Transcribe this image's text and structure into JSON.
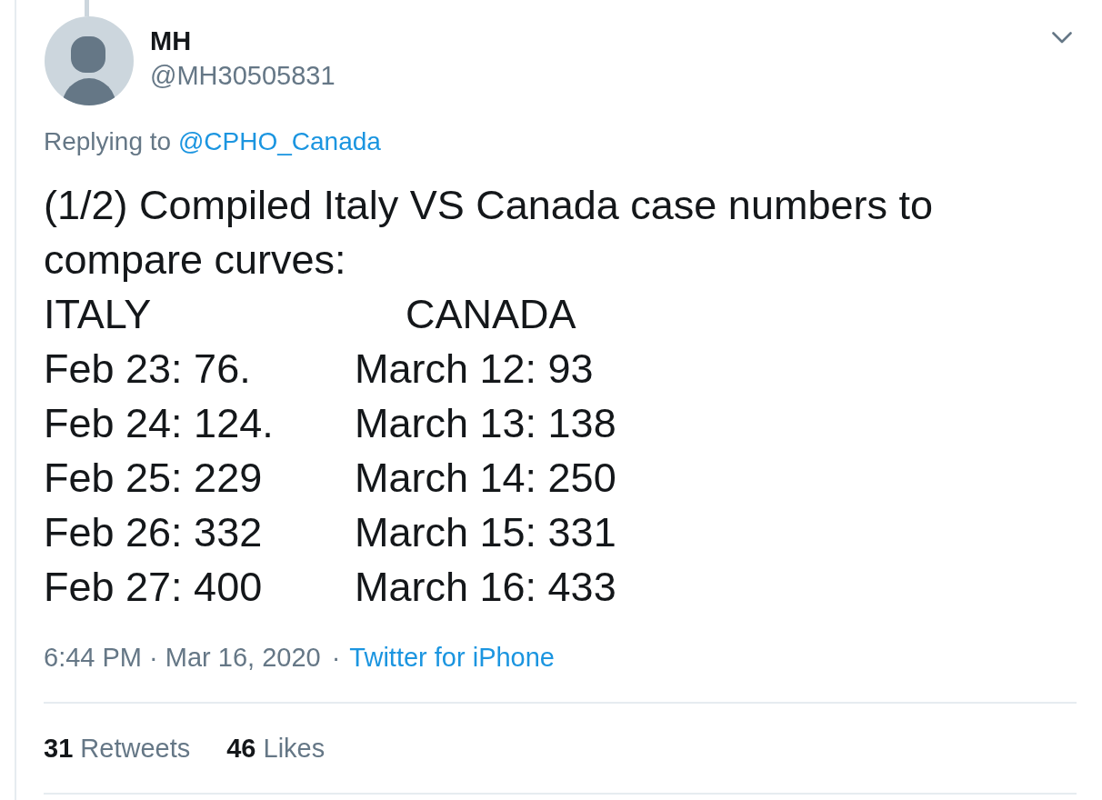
{
  "tweet": {
    "author": {
      "name": "MH",
      "handle": "@MH30505831"
    },
    "reply_to": {
      "label": "Replying to",
      "handle": "@CPHO_Canada"
    },
    "text": "(1/2) Compiled Italy VS Canada case numbers to compare curves:",
    "case_table": {
      "columns": [
        "ITALY",
        "CANADA"
      ],
      "rows": [
        [
          "Feb 23: 76.",
          "March 12: 93"
        ],
        [
          "Feb 24: 124.",
          "March 13: 138"
        ],
        [
          "Feb 25: 229",
          "March 14: 250"
        ],
        [
          "Feb 26: 332",
          "March 15: 331"
        ],
        [
          "Feb 27: 400",
          "March 16: 433"
        ]
      ]
    },
    "timestamp": "6:44 PM · Mar 16, 2020",
    "separator": "·",
    "source": "Twitter for iPhone",
    "stats": [
      {
        "count": "31",
        "label": "Retweets"
      },
      {
        "count": "46",
        "label": "Likes"
      }
    ]
  }
}
